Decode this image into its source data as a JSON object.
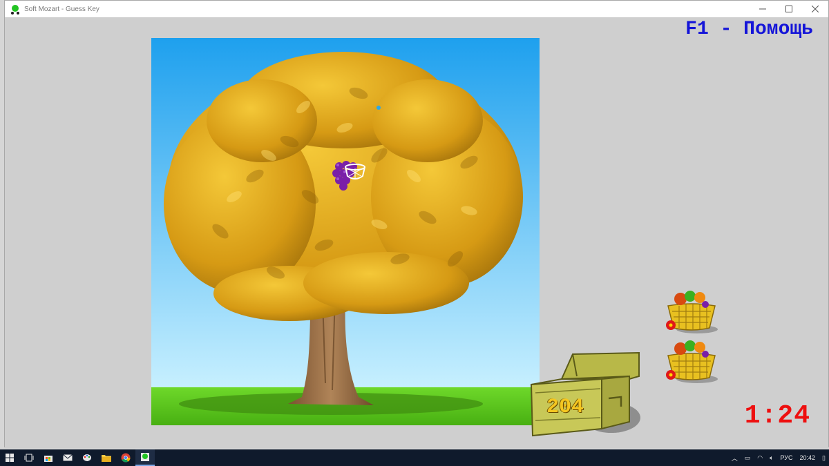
{
  "window": {
    "title": "Soft Mozart - Guess Key",
    "controls": [
      "minimize-icon",
      "maximize-icon",
      "close-icon"
    ]
  },
  "game": {
    "help_hint": "F1 - Помощь",
    "timer": "1:24",
    "score": "204",
    "baskets_remaining": 2,
    "target_fruit": "grape-bunch",
    "colors": {
      "help": "#1414d8",
      "timer": "#ee0f0f",
      "score": "#f4c620",
      "sky_top": "#1ea0ee",
      "sky_bottom": "#c8f0ff",
      "grass": "#5cc81c",
      "foliage": "#e0a818"
    }
  },
  "taskbar": {
    "items": [
      "windows-start-icon",
      "task-view-icon",
      "store-icon",
      "mail-icon",
      "paint-icon",
      "file-explorer-icon",
      "chrome-icon",
      "soft-mozart-icon"
    ],
    "tray": {
      "language": "РУС",
      "clock": "20:42"
    }
  }
}
